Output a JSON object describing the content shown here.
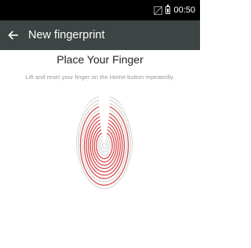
{
  "status_bar": {
    "time": "00:50",
    "icons": [
      "signal-icon",
      "battery-icon"
    ]
  },
  "app_bar": {
    "back_icon": "arrow-left-icon",
    "title": "New fingerprint",
    "background": "#3c4543"
  },
  "main": {
    "heading": "Place Your Finger",
    "instructions": "Lift and reset your finger on the Home button repeatedly.",
    "fingerprint_icon": "fingerprint-icon",
    "progress_color": "#d84a4a",
    "remaining_color": "#d8d8d8"
  }
}
